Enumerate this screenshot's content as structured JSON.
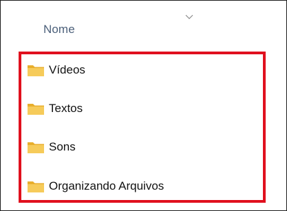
{
  "header": {
    "column_name": "Nome",
    "sort_icon": "chevron-down-icon"
  },
  "items": [
    {
      "label": "Vídeos",
      "icon": "folder-icon"
    },
    {
      "label": "Textos",
      "icon": "folder-icon"
    },
    {
      "label": "Sons",
      "icon": "folder-icon"
    },
    {
      "label": "Organizando Arquivos",
      "icon": "folder-icon"
    }
  ],
  "colors": {
    "highlight": "#e0101e",
    "folder": "#f4c64b",
    "header_text": "#4c607a"
  }
}
